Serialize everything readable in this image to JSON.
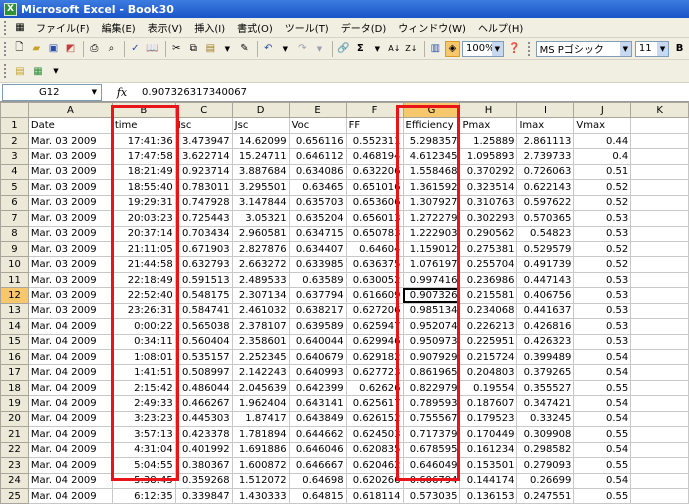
{
  "window": {
    "title": "Microsoft Excel - Book30",
    "app_icon": "excel-icon"
  },
  "menu": [
    "ファイル(F)",
    "編集(E)",
    "表示(V)",
    "挿入(I)",
    "書式(O)",
    "ツール(T)",
    "データ(D)",
    "ウィンドウ(W)",
    "ヘルプ(H)"
  ],
  "toolbar": {
    "zoom": "100%",
    "font_name": "MS Pゴシック",
    "font_size": "11",
    "bold": "B"
  },
  "formula_bar": {
    "name_box": "G12",
    "fx": "fx",
    "value": "0.907326317340067"
  },
  "columns": [
    "A",
    "B",
    "C",
    "D",
    "E",
    "F",
    "G",
    "H",
    "I",
    "J",
    "K"
  ],
  "headers": [
    "Date",
    "time",
    "Isc",
    "Jsc",
    "Voc",
    "FF",
    "Efficiency",
    "Pmax",
    "Imax",
    "Vmax",
    ""
  ],
  "rows": [
    {
      "n": "2",
      "c": [
        "Mar. 03 2009",
        "17:41:36",
        "3.473947",
        "14.62099",
        "0.656116",
        "0.552311",
        "5.298357",
        "1.25889",
        "2.861113",
        "0.44",
        ""
      ]
    },
    {
      "n": "3",
      "c": [
        "Mar. 03 2009",
        "17:47:58",
        "3.622714",
        "15.24711",
        "0.646112",
        "0.468194",
        "4.612345",
        "1.095893",
        "2.739733",
        "0.4",
        ""
      ]
    },
    {
      "n": "4",
      "c": [
        "Mar. 03 2009",
        "18:21:49",
        "0.923714",
        "3.887684",
        "0.634086",
        "0.632206",
        "1.558468",
        "0.370292",
        "0.726063",
        "0.51",
        ""
      ]
    },
    {
      "n": "5",
      "c": [
        "Mar. 03 2009",
        "18:55:40",
        "0.783011",
        "3.295501",
        "0.63465",
        "0.651016",
        "1.361592",
        "0.323514",
        "0.622143",
        "0.52",
        ""
      ]
    },
    {
      "n": "6",
      "c": [
        "Mar. 03 2009",
        "19:29:31",
        "0.747928",
        "3.147844",
        "0.635703",
        "0.653606",
        "1.307927",
        "0.310763",
        "0.597622",
        "0.52",
        ""
      ]
    },
    {
      "n": "7",
      "c": [
        "Mar. 03 2009",
        "20:03:23",
        "0.725443",
        "3.05321",
        "0.635204",
        "0.656013",
        "1.272279",
        "0.302293",
        "0.570365",
        "0.53",
        ""
      ]
    },
    {
      "n": "8",
      "c": [
        "Mar. 03 2009",
        "20:37:14",
        "0.703434",
        "2.960581",
        "0.634715",
        "0.650783",
        "1.222903",
        "0.290562",
        "0.54823",
        "0.53",
        ""
      ]
    },
    {
      "n": "9",
      "c": [
        "Mar. 03 2009",
        "21:11:05",
        "0.671903",
        "2.827876",
        "0.634407",
        "0.64604",
        "1.159012",
        "0.275381",
        "0.529579",
        "0.52",
        ""
      ]
    },
    {
      "n": "10",
      "c": [
        "Mar. 03 2009",
        "21:44:58",
        "0.632793",
        "2.663272",
        "0.633985",
        "0.636375",
        "1.076197",
        "0.255704",
        "0.491739",
        "0.52",
        ""
      ]
    },
    {
      "n": "11",
      "c": [
        "Mar. 03 2009",
        "22:18:49",
        "0.591513",
        "2.489533",
        "0.63589",
        "0.630052",
        "0.997416",
        "0.236986",
        "0.447143",
        "0.53",
        ""
      ]
    },
    {
      "n": "12",
      "c": [
        "Mar. 03 2009",
        "22:52:40",
        "0.548175",
        "2.307134",
        "0.637794",
        "0.616609",
        "0.907326",
        "0.215581",
        "0.406756",
        "0.53",
        ""
      ]
    },
    {
      "n": "13",
      "c": [
        "Mar. 03 2009",
        "23:26:31",
        "0.584741",
        "2.461032",
        "0.638217",
        "0.627206",
        "0.985134",
        "0.234068",
        "0.441637",
        "0.53",
        ""
      ]
    },
    {
      "n": "14",
      "c": [
        "Mar. 04 2009",
        "0:00:22",
        "0.565038",
        "2.378107",
        "0.639589",
        "0.625947",
        "0.952074",
        "0.226213",
        "0.426816",
        "0.53",
        ""
      ]
    },
    {
      "n": "15",
      "c": [
        "Mar. 04 2009",
        "0:34:11",
        "0.560404",
        "2.358601",
        "0.640044",
        "0.629946",
        "0.950973",
        "0.225951",
        "0.426323",
        "0.53",
        ""
      ]
    },
    {
      "n": "16",
      "c": [
        "Mar. 04 2009",
        "1:08:01",
        "0.535157",
        "2.252345",
        "0.640679",
        "0.629182",
        "0.907929",
        "0.215724",
        "0.399489",
        "0.54",
        ""
      ]
    },
    {
      "n": "17",
      "c": [
        "Mar. 04 2009",
        "1:41:51",
        "0.508997",
        "2.142243",
        "0.640993",
        "0.627723",
        "0.861965",
        "0.204803",
        "0.379265",
        "0.54",
        ""
      ]
    },
    {
      "n": "18",
      "c": [
        "Mar. 04 2009",
        "2:15:42",
        "0.486044",
        "2.045639",
        "0.642399",
        "0.62626",
        "0.822979",
        "0.19554",
        "0.355527",
        "0.55",
        ""
      ]
    },
    {
      "n": "19",
      "c": [
        "Mar. 04 2009",
        "2:49:33",
        "0.466267",
        "1.962404",
        "0.643141",
        "0.625617",
        "0.789593",
        "0.187607",
        "0.347421",
        "0.54",
        ""
      ]
    },
    {
      "n": "20",
      "c": [
        "Mar. 04 2009",
        "3:23:23",
        "0.445303",
        "1.87417",
        "0.643849",
        "0.626152",
        "0.755567",
        "0.179523",
        "0.33245",
        "0.54",
        ""
      ]
    },
    {
      "n": "21",
      "c": [
        "Mar. 04 2009",
        "3:57:13",
        "0.423378",
        "1.781894",
        "0.644662",
        "0.624503",
        "0.717379",
        "0.170449",
        "0.309908",
        "0.55",
        ""
      ]
    },
    {
      "n": "22",
      "c": [
        "Mar. 04 2009",
        "4:31:04",
        "0.401992",
        "1.691886",
        "0.646046",
        "0.620835",
        "0.678595",
        "0.161234",
        "0.298582",
        "0.54",
        ""
      ]
    },
    {
      "n": "23",
      "c": [
        "Mar. 04 2009",
        "5:04:55",
        "0.380367",
        "1.600872",
        "0.646667",
        "0.620462",
        "0.646049",
        "0.153501",
        "0.279093",
        "0.55",
        ""
      ]
    },
    {
      "n": "24",
      "c": [
        "Mar. 04 2009",
        "5:38:45",
        "0.359268",
        "1.512072",
        "0.64698",
        "0.620266",
        "0.606794",
        "0.144174",
        "0.26699",
        "0.54",
        ""
      ]
    },
    {
      "n": "25",
      "c": [
        "Mar. 04 2009",
        "6:12:35",
        "0.339847",
        "1.430333",
        "0.64815",
        "0.618114",
        "0.573035",
        "0.136153",
        "0.247551",
        "0.55",
        ""
      ]
    }
  ]
}
